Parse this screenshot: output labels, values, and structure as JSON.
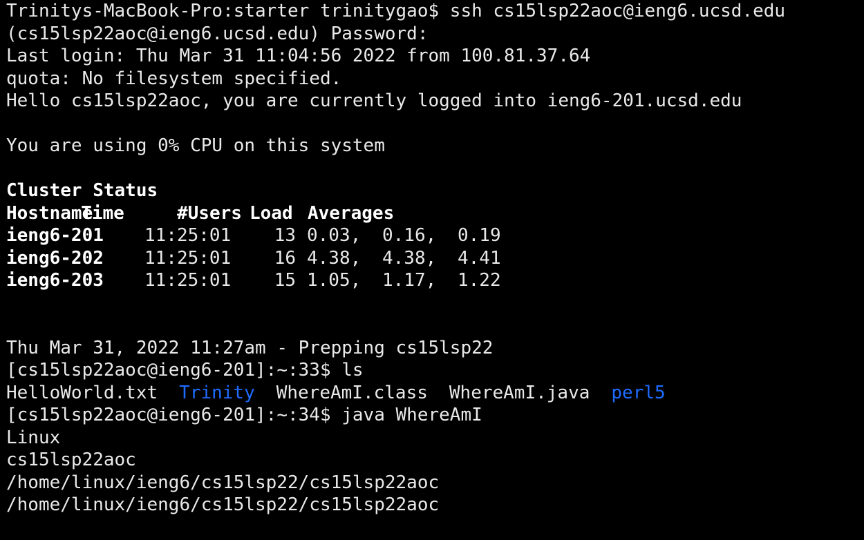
{
  "terminal": {
    "lines": {
      "l01": "Trinitys-MacBook-Pro:starter trinitygao$ ssh cs15lsp22aoc@ieng6.ucsd.edu",
      "l02": "(cs15lsp22aoc@ieng6.ucsd.edu) Password:",
      "l03": "Last login: Thu Mar 31 11:04:56 2022 from 100.81.37.64",
      "l04": "quota: No filesystem specified.",
      "l05": "Hello cs15lsp22aoc, you are currently logged into ieng6-201.ucsd.edu",
      "l07": "You are using 0% CPU on this system",
      "l09": "Cluster Status",
      "l16": "Thu Mar 31, 2022 11:27am - Prepping cs15lsp22",
      "l17": "[cs15lsp22aoc@ieng6-201]:~:33$ ls",
      "l19": "[cs15lsp22aoc@ieng6-201]:~:34$ java WhereAmI",
      "l20": "Linux",
      "l21": "cs15lsp22aoc",
      "l22": "/home/linux/ieng6/cs15lsp22/cs15lsp22aoc",
      "l23": "/home/linux/ieng6/cs15lsp22/cs15lsp22aoc"
    },
    "cluster": {
      "headers": {
        "hostname": "Hostname",
        "time": "Time",
        "users": "#Users",
        "load": "Load",
        "averages": "Averages"
      },
      "rows": [
        {
          "host": "ieng6-201",
          "time": "11:25:01",
          "users": "13",
          "l1": "0.03,",
          "l5": "0.16,",
          "l15": "0.19"
        },
        {
          "host": "ieng6-202",
          "time": "11:25:01",
          "users": "16",
          "l1": "4.38,",
          "l5": "4.38,",
          "l15": "4.41"
        },
        {
          "host": "ieng6-203",
          "time": "11:25:01",
          "users": "15",
          "l1": "1.05,",
          "l5": "1.17,",
          "l15": "1.22"
        }
      ]
    },
    "ls_output": [
      {
        "name": "HelloWorld.txt",
        "type": "file"
      },
      {
        "name": "Trinity",
        "type": "directory"
      },
      {
        "name": "WhereAmI.class",
        "type": "file"
      },
      {
        "name": "WhereAmI.java",
        "type": "file"
      },
      {
        "name": "perl5",
        "type": "directory"
      }
    ],
    "colors": {
      "background": "#000000",
      "foreground": "#e9e9e9",
      "directory": "#1f6bff"
    }
  }
}
